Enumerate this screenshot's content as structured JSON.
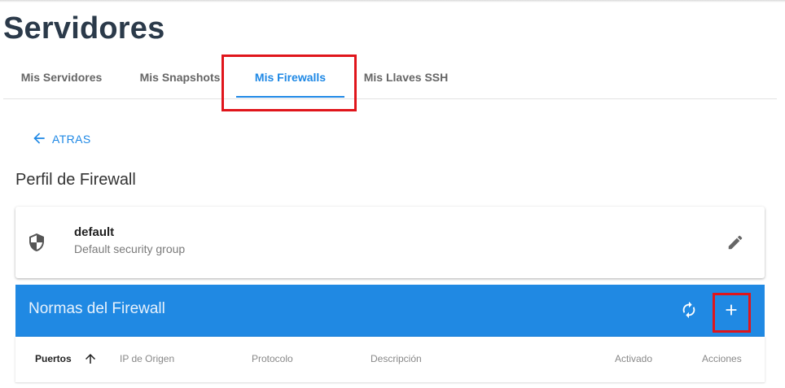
{
  "page": {
    "title": "Servidores"
  },
  "tabs": [
    {
      "label": "Mis Servidores",
      "active": false
    },
    {
      "label": "Mis Snapshots",
      "active": false
    },
    {
      "label": "Mis Firewalls",
      "active": true
    },
    {
      "label": "Mis Llaves SSH",
      "active": false
    }
  ],
  "back": {
    "label": "ATRAS",
    "icon": "arrow-left-icon"
  },
  "section": {
    "title": "Perfil de Firewall"
  },
  "profile": {
    "name": "default",
    "description": "Default security group",
    "icon": "shield-icon",
    "edit_icon": "pencil-icon"
  },
  "rules": {
    "title": "Normas del Firewall",
    "refresh_icon": "refresh-icon",
    "add_icon": "plus-icon",
    "columns": [
      "Puertos",
      "IP de Origen",
      "Protocolo",
      "Descripción",
      "Activado",
      "Acciones"
    ],
    "sorted_column": "Puertos",
    "sort_direction": "ascending"
  },
  "colors": {
    "accent": "#1e88e5",
    "header_bar": "#2089e3",
    "highlight": "#e0151b",
    "title": "#2b3a4a"
  }
}
